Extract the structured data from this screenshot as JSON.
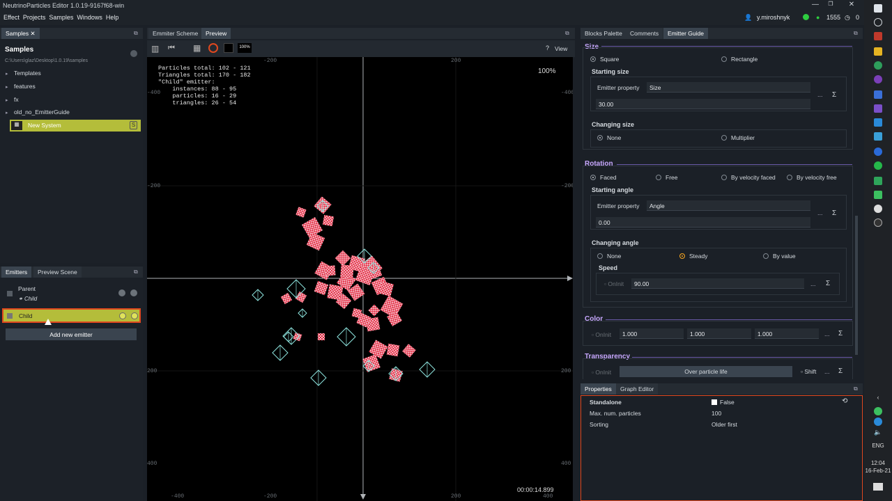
{
  "window": {
    "title": "NeutrinoParticles Editor 1.0.19-9167f68-win",
    "min_icon": "minimize-icon",
    "max_icon": "restore-icon",
    "close_icon": "close-icon"
  },
  "menu": {
    "items": [
      "Effect",
      "Projects",
      "Samples",
      "Windows",
      "Help"
    ],
    "user": "y.miroshnyk",
    "count": "1555",
    "clock_value": "0"
  },
  "samples_panel": {
    "tab": "Samples",
    "heading": "Samples",
    "path": "C:\\Users\\glaz\\Desktop\\1.0.19\\samples",
    "tree": [
      "Templates",
      "features",
      "fx",
      "old_no_EmitterGuide"
    ],
    "selected": "New System",
    "selected_badge": "S"
  },
  "emitters_panel": {
    "tabs": [
      "Emitters",
      "Preview Scene"
    ],
    "parent": "Parent",
    "child_link": "Child",
    "child": "Child",
    "add_button": "Add new emitter"
  },
  "center": {
    "tabs": [
      "Emmiter Scheme",
      "Preview"
    ],
    "zoom_button": "100%",
    "help": "?",
    "view_button": "View",
    "stats": [
      "Particles total: 102 - 121",
      "Triangles total: 170 - 182",
      "\"Child\" emitter:",
      "    instances: 88 - 95",
      "    particles: 16 - 29",
      "    triangles: 26 - 54"
    ],
    "zoom_label": "100%",
    "time": "00:00:14.899",
    "axis_labels": {
      "top": [
        "-200",
        "200"
      ],
      "bottom": [
        "-400",
        "-200",
        "200",
        "400"
      ],
      "left": [
        "-400",
        "-200",
        "200",
        "400"
      ],
      "right": [
        "-400",
        "-200",
        "200",
        "400"
      ]
    }
  },
  "right_tabs": [
    "Blocks Palette",
    "Comments",
    "Emitter Guide"
  ],
  "guide": {
    "size": {
      "title": "Size",
      "shape_options": [
        "Square",
        "Rectangle"
      ],
      "starting_size_label": "Starting size",
      "emitter_property_label": "Emitter property",
      "emitter_property_value": "Size",
      "value": "30.00",
      "changing_size_label": "Changing size",
      "changing_options": [
        "None",
        "Multiplier"
      ]
    },
    "rotation": {
      "title": "Rotation",
      "options": [
        "Faced",
        "Free",
        "By velocity faced",
        "By velocity free"
      ],
      "starting_angle_label": "Starting angle",
      "emitter_property_label": "Emitter property",
      "emitter_property_value": "Angle",
      "value": "0.00",
      "changing_angle_label": "Changing angle",
      "changing_options": [
        "None",
        "Steady",
        "By value"
      ],
      "speed_label": "Speed",
      "onInit_label": "OnInit",
      "speed_value": "90.00"
    },
    "color": {
      "title": "Color",
      "onInit_label": "OnInit",
      "values": [
        "1.000",
        "1.000",
        "1.000"
      ]
    },
    "transparency": {
      "title": "Transparency",
      "onInit_label": "OnInit",
      "mode_button": "Over particle life",
      "shift_label": "Shift"
    },
    "more": "...",
    "sigma": "Σ"
  },
  "properties": {
    "tabs": [
      "Properties",
      "Graph Editor"
    ],
    "rows": [
      {
        "name": "Standalone",
        "value": "False"
      },
      {
        "name": "Max. num. particles",
        "value": "100"
      },
      {
        "name": "Sorting",
        "value": "Older first"
      }
    ]
  },
  "taskbar": {
    "lang": "ENG",
    "time": "12:04",
    "date": "16-Feb-21"
  }
}
